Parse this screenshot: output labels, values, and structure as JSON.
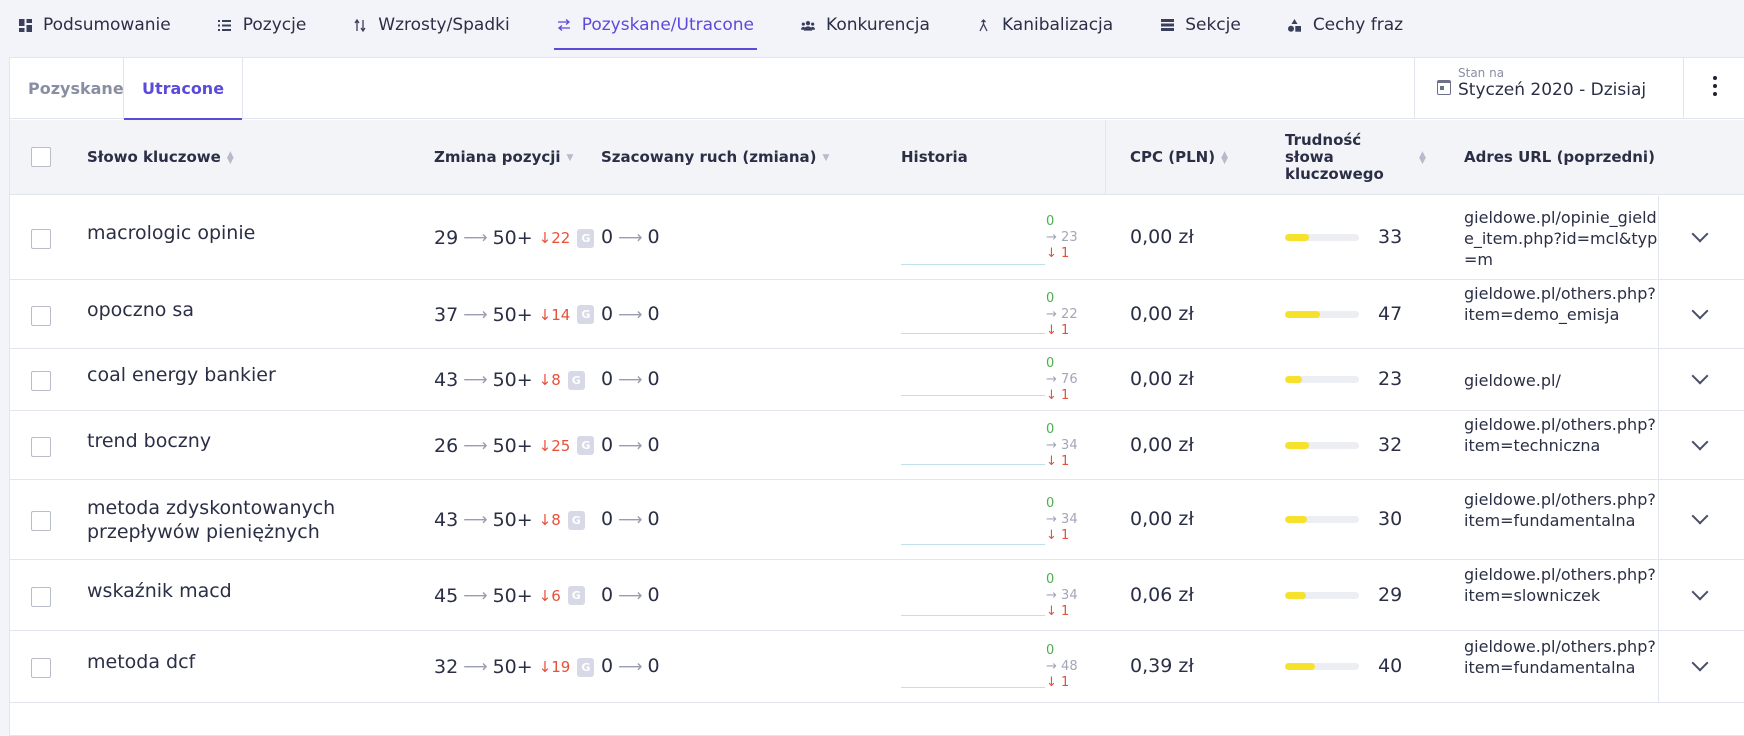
{
  "nav": [
    {
      "label": "Podsumowanie",
      "icon": "dashboard-icon"
    },
    {
      "label": "Pozycje",
      "icon": "list-icon"
    },
    {
      "label": "Wzrosty/Spadki",
      "icon": "up-down-icon"
    },
    {
      "label": "Pozyskane/Utracone",
      "icon": "swap-icon",
      "active": true
    },
    {
      "label": "Konkurencja",
      "icon": "people-icon"
    },
    {
      "label": "Kanibalizacja",
      "icon": "merge-icon"
    },
    {
      "label": "Sekcje",
      "icon": "sections-icon"
    },
    {
      "label": "Cechy fraz",
      "icon": "shapes-icon"
    }
  ],
  "subtabs": {
    "gained": "Pozyskane",
    "lost": "Utracone",
    "active": "lost"
  },
  "date": {
    "caption": "Stan na",
    "value": "Styczeń 2020 - Dzisiaj"
  },
  "columns": {
    "keyword": "Słowo kluczowe",
    "position_change": "Zmiana pozycji",
    "traffic": "Szacowany ruch (zmiana)",
    "history": "Historia",
    "cpc": "CPC (PLN)",
    "difficulty": "Trudność słowa kluczowego",
    "url": "Adres URL (poprzedni)"
  },
  "rows": [
    {
      "keyword": "macrologic opinie",
      "pos_from": "29",
      "pos_to": "50+",
      "delta": "22",
      "traffic_from": "0",
      "traffic_to": "0",
      "hist_up": "0",
      "hist_same": "23",
      "hist_down": "1",
      "cpc": "0,00 zł",
      "difficulty": 33,
      "url": "gieldowe.pl/opinie_gielde_item.php?id=mcl&typ=m"
    },
    {
      "keyword": "opoczno sa",
      "pos_from": "37",
      "pos_to": "50+",
      "delta": "14",
      "traffic_from": "0",
      "traffic_to": "0",
      "hist_up": "0",
      "hist_same": "22",
      "hist_down": "1",
      "cpc": "0,00 zł",
      "difficulty": 47,
      "url": "gieldowe.pl/others.php?item=demo_emisja"
    },
    {
      "keyword": "coal energy bankier",
      "pos_from": "43",
      "pos_to": "50+",
      "delta": "8",
      "traffic_from": "0",
      "traffic_to": "0",
      "hist_up": "0",
      "hist_same": "76",
      "hist_down": "1",
      "cpc": "0,00 zł",
      "difficulty": 23,
      "url": "gieldowe.pl/"
    },
    {
      "keyword": "trend boczny",
      "pos_from": "26",
      "pos_to": "50+",
      "delta": "25",
      "traffic_from": "0",
      "traffic_to": "0",
      "hist_up": "0",
      "hist_same": "34",
      "hist_down": "1",
      "cpc": "0,00 zł",
      "difficulty": 32,
      "url": "gieldowe.pl/others.php?item=techniczna"
    },
    {
      "keyword": "metoda zdyskontowanych przepływów pieniężnych",
      "pos_from": "43",
      "pos_to": "50+",
      "delta": "8",
      "traffic_from": "0",
      "traffic_to": "0",
      "hist_up": "0",
      "hist_same": "34",
      "hist_down": "1",
      "cpc": "0,00 zł",
      "difficulty": 30,
      "url": "gieldowe.pl/others.php?item=fundamentalna"
    },
    {
      "keyword": "wskaźnik macd",
      "pos_from": "45",
      "pos_to": "50+",
      "delta": "6",
      "traffic_from": "0",
      "traffic_to": "0",
      "hist_up": "0",
      "hist_same": "34",
      "hist_down": "1",
      "cpc": "0,06 zł",
      "difficulty": 29,
      "url": "gieldowe.pl/others.php?item=slowniczek"
    },
    {
      "keyword": "metoda dcf",
      "pos_from": "32",
      "pos_to": "50+",
      "delta": "19",
      "traffic_from": "0",
      "traffic_to": "0",
      "hist_up": "0",
      "hist_same": "48",
      "hist_down": "1",
      "cpc": "0,39 zł",
      "difficulty": 40,
      "url": "gieldowe.pl/others.php?item=fundamentalna"
    }
  ],
  "glyphs": {
    "arrow": "⟶",
    "down": "↓",
    "right": "→",
    "google": "G"
  }
}
